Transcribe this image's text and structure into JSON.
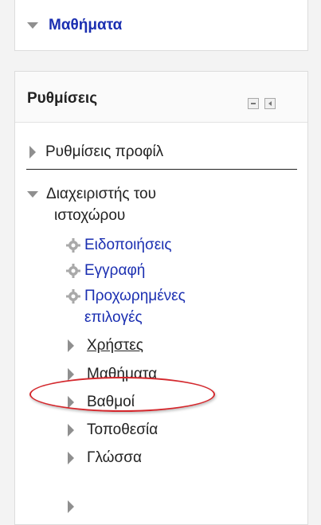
{
  "top_block": {
    "courses_label": "Μαθήματα"
  },
  "settings_block": {
    "title": "Ρυθμίσεις",
    "profile_settings": "Ρυθμίσεις προφίλ",
    "site_admin_line1": "Διαχειριστής του",
    "site_admin_line2": "ιστοχώρου",
    "notifications": "Ειδοποιήσεις",
    "registration": "Εγγραφή",
    "advanced_line1": "Προχωρημένες",
    "advanced_line2": "επιλογές",
    "users": "Χρήστες",
    "courses": "Μαθήματα",
    "grades": "Βαθμοί",
    "location": "Τοποθεσία",
    "language": "Γλώσσα"
  },
  "colors": {
    "link_blue": "#1b2fb1",
    "highlight_red": "#d4282d",
    "icon_gray": "#8f8f8f"
  }
}
